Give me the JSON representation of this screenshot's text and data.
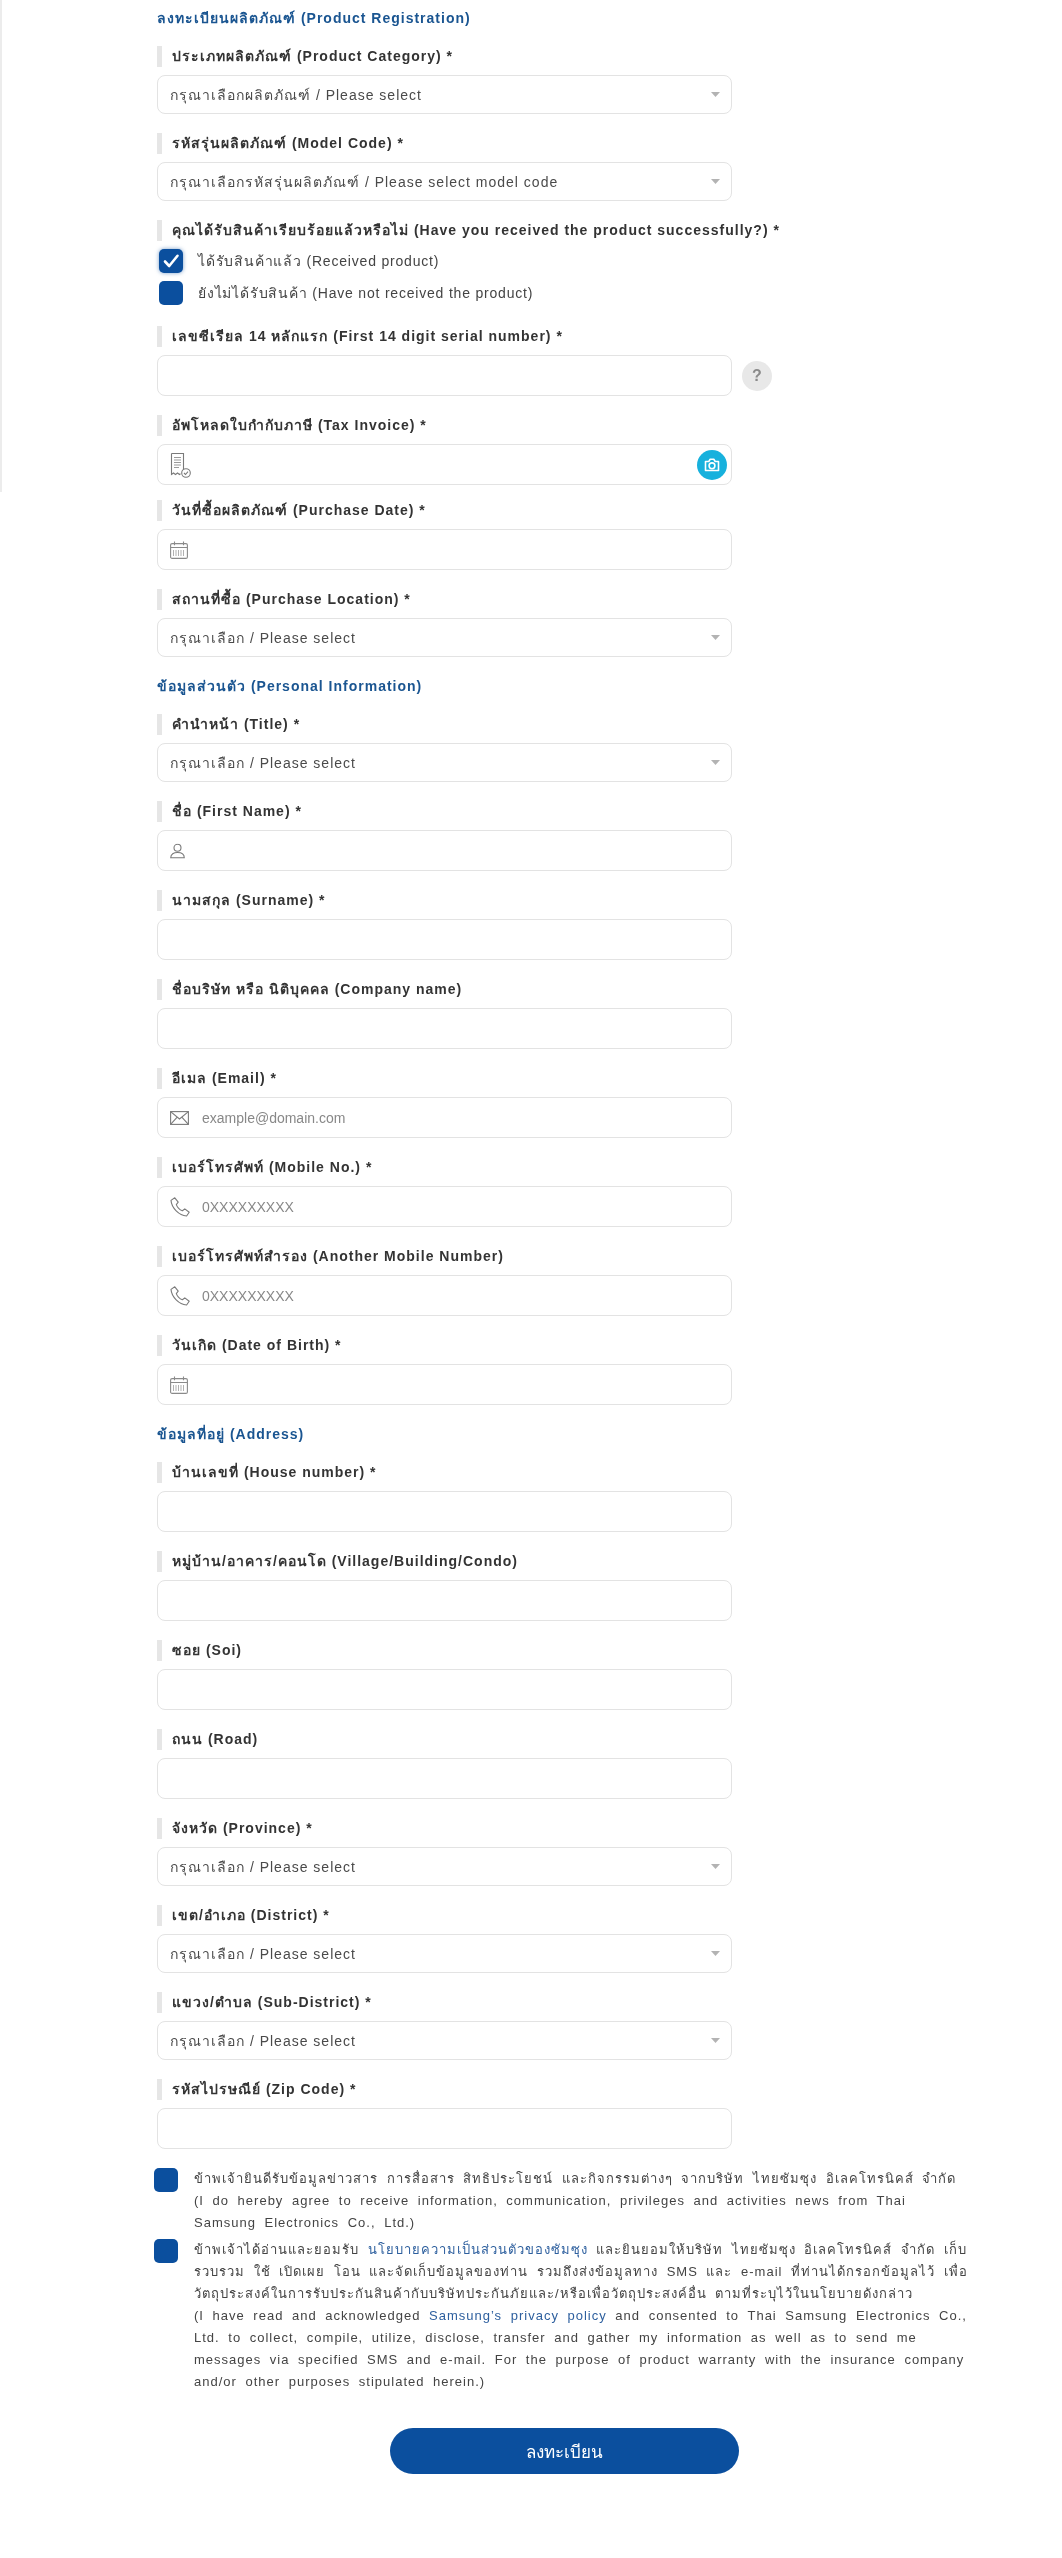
{
  "sections": [
    {
      "title": "ลงทะเบียนผลิตภัณฑ์ (Product Registration)",
      "fields": [
        {
          "kind": "select",
          "label": "ประเภทผลิตภัณฑ์ (Product Category) *",
          "placeholder": "กรุณาเลือกผลิตภัณฑ์ / Please select"
        },
        {
          "kind": "select",
          "label": "รหัสรุ่นผลิตภัณฑ์ (Model Code) *",
          "placeholder": "กรุณาเลือกรหัสรุ่นผลิตภัณฑ์ / Please select model code"
        },
        {
          "kind": "checkboxes",
          "label": "คุณได้รับสินค้าเรียบร้อยแล้วหรือไม่ (Have you received the product successfully?) *",
          "options": [
            {
              "label": "ได้รับสินค้าแล้ว (Received product)",
              "checked": true
            },
            {
              "label": "ยังไม่ได้รับสินค้า (Have not received the product)",
              "checked": false
            }
          ]
        },
        {
          "kind": "text",
          "label": "เลขซีเรียล 14 หลักแรก (First 14 digit serial number) *",
          "help": "?"
        },
        {
          "kind": "upload",
          "label": "อัพโหลดใบกำกับภาษี (Tax Invoice) *"
        },
        {
          "kind": "date",
          "label": "วันที่ซื้อผลิตภัณฑ์ (Purchase Date) *"
        },
        {
          "kind": "select",
          "label": "สถานที่ซื้อ (Purchase Location) *",
          "placeholder": "กรุณาเลือก / Please select"
        }
      ]
    },
    {
      "title": "ข้อมูลส่วนตัว (Personal Information)",
      "fields": [
        {
          "kind": "select",
          "label": "คำนำหน้า (Title) *",
          "placeholder": "กรุณาเลือก / Please select"
        },
        {
          "kind": "name",
          "label": "ชื่อ (First Name) *"
        },
        {
          "kind": "text",
          "label": "นามสกุล (Surname) *"
        },
        {
          "kind": "text",
          "label": "ชื่อบริษัท หรือ นิติบุคคล (Company name)"
        },
        {
          "kind": "email",
          "label": "อีเมล (Email) *",
          "placeholder": "example@domain.com"
        },
        {
          "kind": "phone",
          "label": "เบอร์โทรศัพท์ (Mobile No.) *",
          "placeholder": "0XXXXXXXXX"
        },
        {
          "kind": "phone",
          "label": "เบอร์โทรศัพท์สำรอง (Another Mobile Number)",
          "placeholder": "0XXXXXXXXX"
        },
        {
          "kind": "date",
          "label": "วันเกิด (Date of Birth) *"
        }
      ]
    },
    {
      "title": "ข้อมูลที่อยู่ (Address)",
      "fields": [
        {
          "kind": "text",
          "label": "บ้านเลขที่ (House number) *"
        },
        {
          "kind": "text",
          "label": "หมู่บ้าน/อาคาร/คอนโด (Village/Building/Condo)"
        },
        {
          "kind": "text",
          "label": "ซอย (Soi)"
        },
        {
          "kind": "text",
          "label": "ถนน (Road)"
        },
        {
          "kind": "select",
          "label": "จังหวัด (Province) *",
          "placeholder": "กรุณาเลือก / Please select"
        },
        {
          "kind": "select",
          "label": "เขต/อำเภอ (District) *",
          "placeholder": "กรุณาเลือก / Please select"
        },
        {
          "kind": "select",
          "label": "แขวง/ตำบล (Sub-District) *",
          "placeholder": "กรุณาเลือก / Please select"
        },
        {
          "kind": "text",
          "label": "รหัสไปรษณีย์ (Zip Code) *"
        }
      ]
    }
  ],
  "consents": [
    {
      "checked": false,
      "paragraphs": [
        {
          "parts": [
            {
              "kind": "text",
              "text": "ข้าพเจ้ายินดีรับข้อมูลข่าวสาร การสื่อสาร สิทธิประโยชน์ และกิจกรรมต่างๆ จากบริษัท ไทยซัมซุง อิเลคโทรนิคส์ จำกัด"
            }
          ]
        },
        {
          "parts": [
            {
              "kind": "text",
              "text": "(I do hereby agree to receive information, communication, privileges and activities news from Thai Samsung Electronics Co., Ltd.)"
            }
          ]
        }
      ]
    },
    {
      "checked": false,
      "paragraphs": [
        {
          "parts": [
            {
              "kind": "text",
              "text": "ข้าพเจ้าได้อ่านและยอมรับ "
            },
            {
              "kind": "link",
              "text": "นโยบายความเป็นส่วนตัวของซัมซุง"
            },
            {
              "kind": "text",
              "text": " และยินยอมให้บริษัท ไทยซัมซุง อิเลคโทรนิคส์ จำกัด เก็บรวบรวม ใช้ เปิดเผย โอน และจัดเก็บข้อมูลของท่าน รวมถึงส่งข้อมูลทาง SMS และ e-mail ที่ท่านได้กรอกข้อมูลไว้ เพื่อวัตถุประสงค์ในการรับประกันสินค้ากับบริษัทประกันภัยและ/หรือเพื่อวัตถุประสงค์อื่น ตามที่ระบุไว้ในนโยบายดังกล่าว"
            }
          ]
        },
        {
          "parts": [
            {
              "kind": "text",
              "text": "(I have read and acknowledged "
            },
            {
              "kind": "link",
              "text": "Samsung’s privacy policy"
            },
            {
              "kind": "text",
              "text": " and consented to Thai Samsung Electronics Co., Ltd. to collect, compile, utilize, disclose, transfer and gather my information as well as to send me messages via specified SMS and e-mail. For the purpose of product warranty with the insurance company and/or other purposes stipulated herein.)"
            }
          ]
        }
      ]
    }
  ],
  "submit_button": "ลงทะเบียน"
}
